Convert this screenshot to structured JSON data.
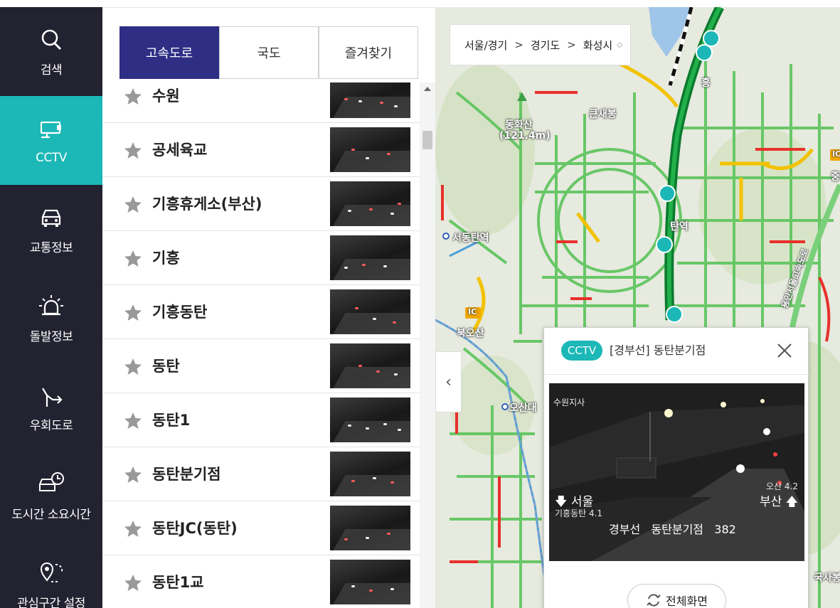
{
  "nav": {
    "items": [
      {
        "label": "검색",
        "icon": "search-icon"
      },
      {
        "label": "CCTV",
        "icon": "cctv-icon",
        "active": true
      },
      {
        "label": "교통정보",
        "icon": "car-icon"
      },
      {
        "label": "돌발정보",
        "icon": "siren-icon"
      },
      {
        "label": "우회도로",
        "icon": "detour-arrow-icon"
      },
      {
        "label": "도시간 소요시간",
        "icon": "car-clock-icon"
      },
      {
        "label": "관심구간 설정",
        "icon": "location-pin-icon"
      }
    ],
    "active_color": "#1cb7b7",
    "bg_color": "#222231"
  },
  "tabs": [
    {
      "label": "고속도로",
      "active": true
    },
    {
      "label": "국도"
    },
    {
      "label": "즐겨찾기"
    }
  ],
  "cctv_list": [
    {
      "name": "수원"
    },
    {
      "name": "공세육교"
    },
    {
      "name": "기흥휴게소(부산)"
    },
    {
      "name": "기흥"
    },
    {
      "name": "기흥동탄"
    },
    {
      "name": "동탄"
    },
    {
      "name": "동탄1"
    },
    {
      "name": "동탄분기점"
    },
    {
      "name": "동탄JC(동탄)"
    },
    {
      "name": "동탄1교"
    }
  ],
  "map": {
    "breadcrumb": [
      "서울/경기",
      "경기도",
      "화성시"
    ],
    "labels": {
      "mountain": "동화산",
      "mountain_height": "(121.4m)",
      "peak": "큰새봉",
      "station_1": "서동탄역",
      "station_2": "탄역",
      "ic_label": "IC",
      "area_1": "북오산",
      "area_2": "오산대",
      "area_3": "국사봉",
      "area_4": "흥",
      "area_5": "중리",
      "area_6": "용인서울고속도로"
    }
  },
  "popup": {
    "badge": "CCTV",
    "title": "[경부선] 동탄분기점",
    "video": {
      "source": "수원지사",
      "left_dir": "서울",
      "left_sub": "기흥동탄 4.1",
      "right_sub": "오산 4.2",
      "right_dir": "부산",
      "caption": "경부선   동탄분기점   382"
    },
    "fullscreen_label": "전체화면"
  }
}
